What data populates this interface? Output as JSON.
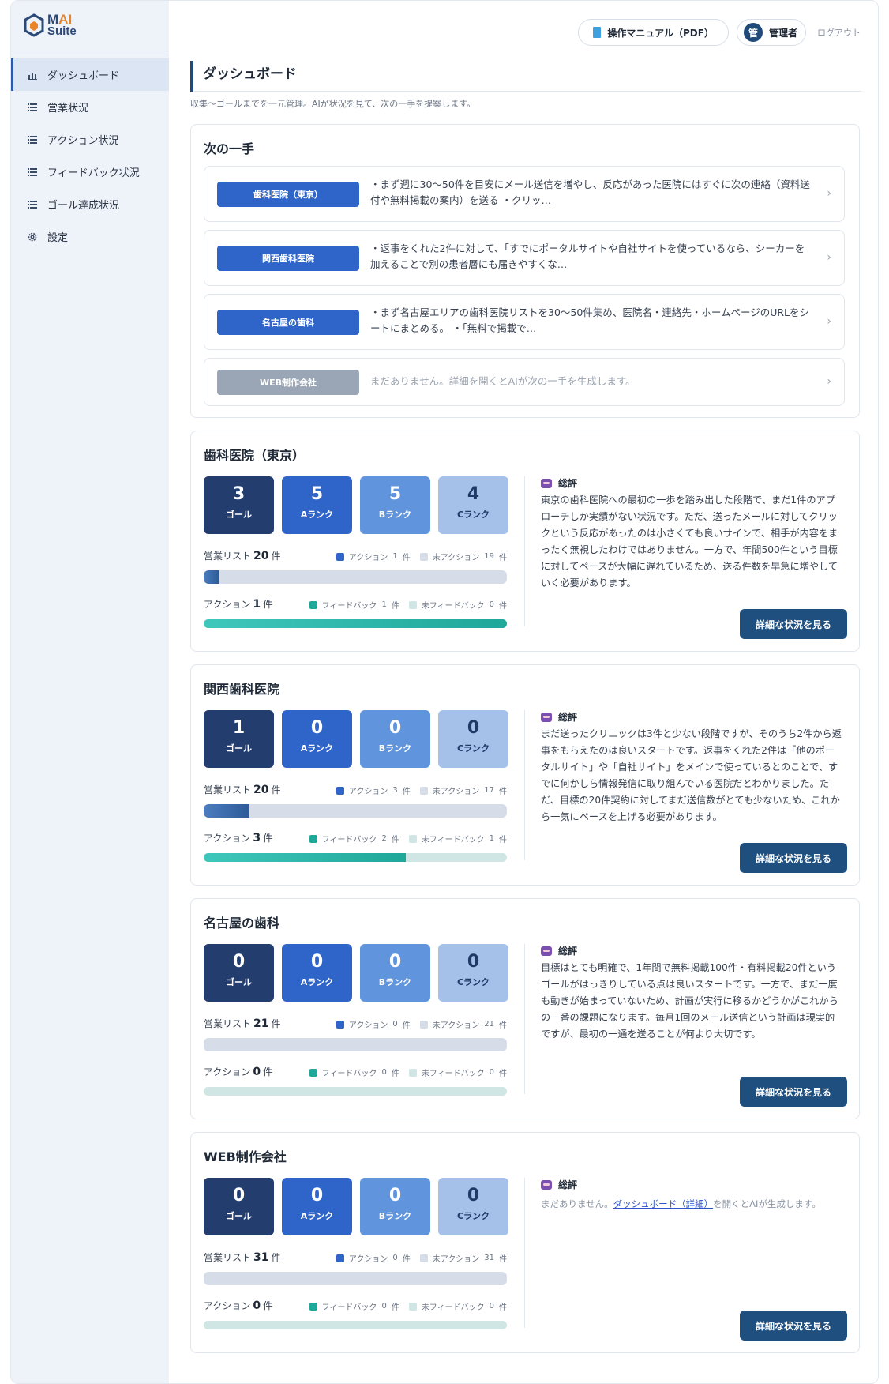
{
  "app": {
    "logo_m": "M",
    "logo_ai": "AI",
    "logo_suite": "Suite"
  },
  "sidebar": {
    "items": [
      {
        "label": "ダッシュボード",
        "icon": "bar-chart-icon"
      },
      {
        "label": "営業状況",
        "icon": "list-icon"
      },
      {
        "label": "アクション状況",
        "icon": "list-icon"
      },
      {
        "label": "フィードバック状況",
        "icon": "list-icon"
      },
      {
        "label": "ゴール達成状況",
        "icon": "list-icon"
      },
      {
        "label": "設定",
        "icon": "gear-icon"
      }
    ]
  },
  "header": {
    "manual_label": "操作マニュアル（PDF）",
    "user_avatar": "管",
    "user_label": "管理者",
    "logout_label": "ログアウト"
  },
  "page": {
    "title": "ダッシュボード",
    "subtitle": "収集〜ゴールまでを一元管理。AIが状況を見て、次の一手を提案します。"
  },
  "next_moves": {
    "title": "次の一手",
    "items": [
      {
        "name": "歯科医院（東京）",
        "text": "・まず週に30〜50件を目安にメール送信を増やし、反応があった医院にはすぐに次の連絡（資料送付や無料掲載の案内）を送る ・クリッ…"
      },
      {
        "name": "関西歯科医院",
        "text": "・返事をくれた2件に対して、「すでにポータルサイトや自社サイトを使っているなら、シーカーを加えることで別の患者層にも届きやすくな…"
      },
      {
        "name": "名古屋の歯科",
        "text": "・まず名古屋エリアの歯科医院リストを30〜50件集め、医院名・連絡先・ホームページのURLをシートにまとめる。 ・「無料で掲載で…"
      },
      {
        "name": "WEB制作会社",
        "text": "まだありません。詳細を開くとAIが次の一手を生成します。"
      }
    ],
    "chevron": "›"
  },
  "labels": {
    "goal": "ゴール",
    "a_rank": "Aランク",
    "b_rank": "Bランク",
    "c_rank": "Cランク",
    "sales_list": "営業リスト",
    "action": "アクション",
    "unit": "件",
    "legend_action": "アクション",
    "legend_no_action": "未アクション",
    "legend_feedback": "フィードバック",
    "legend_no_feedback": "未フィードバック",
    "review": "総評",
    "detail_button": "詳細な状況を見る"
  },
  "projects": [
    {
      "name": "歯科医院（東京）",
      "goal": "3",
      "a": "5",
      "b": "5",
      "c": "4",
      "sales_list": "20",
      "action_count": "1",
      "no_action_count": "19",
      "actions": "1",
      "feedback": "1",
      "no_feedback": "0",
      "sales_progress": 0.05,
      "feedback_progress": 1.0,
      "review": "東京の歯科医院への最初の一歩を踏み出した段階で、まだ1件のアプローチしか実績がない状況です。ただ、送ったメールに対してクリックという反応があったのは小さくても良いサインで、相手が内容をまったく無視したわけではありません。一方で、年間500件という目標に対してペースが大幅に遅れているため、送る件数を早急に増やしていく必要があります。"
    },
    {
      "name": "関西歯科医院",
      "goal": "1",
      "a": "0",
      "b": "0",
      "c": "0",
      "sales_list": "20",
      "action_count": "3",
      "no_action_count": "17",
      "actions": "3",
      "feedback": "2",
      "no_feedback": "1",
      "sales_progress": 0.15,
      "feedback_progress": 0.667,
      "review": "まだ送ったクリニックは3件と少ない段階ですが、そのうち2件から返事をもらえたのは良いスタートです。返事をくれた2件は「他のポータルサイト」や「自社サイト」をメインで使っているとのことで、すでに何かしら情報発信に取り組んでいる医院だとわかりました。ただ、目標の20件契約に対してまだ送信数がとても少ないため、これから一気にペースを上げる必要があります。"
    },
    {
      "name": "名古屋の歯科",
      "goal": "0",
      "a": "0",
      "b": "0",
      "c": "0",
      "sales_list": "21",
      "action_count": "0",
      "no_action_count": "21",
      "actions": "0",
      "feedback": "0",
      "no_feedback": "0",
      "sales_progress": 0.0,
      "feedback_progress": 0.0,
      "review": "目標はとても明確で、1年間で無料掲載100件・有料掲載20件というゴールがはっきりしている点は良いスタートです。一方で、まだ一度も動きが始まっていないため、計画が実行に移るかどうかがこれからの一番の課題になります。毎月1回のメール送信という計画は現実的ですが、最初の一通を送ることが何より大切です。"
    },
    {
      "name": "WEB制作会社",
      "goal": "0",
      "a": "0",
      "b": "0",
      "c": "0",
      "sales_list": "31",
      "action_count": "0",
      "no_action_count": "31",
      "actions": "0",
      "feedback": "0",
      "no_feedback": "0",
      "sales_progress": 0.0,
      "feedback_progress": 0.0,
      "review_prefix": "まだありません。",
      "review_link": "ダッシュボード（詳細）",
      "review_suffix": "を開くとAIが生成します。"
    }
  ],
  "colors": {
    "navy": "#1f4f7f",
    "accent_blue": "#2f64c8",
    "teal": "#22b5a3",
    "muted_bar": "#d6dde8",
    "light_teal": "#cfe6e4"
  }
}
